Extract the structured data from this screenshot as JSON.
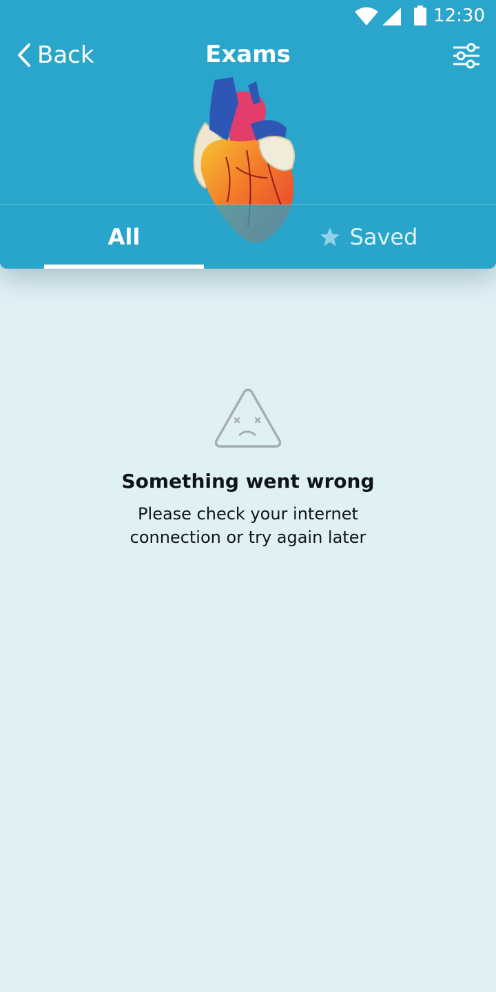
{
  "status_bar": {
    "time": "12:30",
    "icons": [
      "wifi-icon",
      "signal-icon",
      "battery-icon"
    ]
  },
  "header": {
    "back_label": "Back",
    "title": "Exams",
    "filter_icon": "sliders-icon",
    "image": "anatomical-heart-model"
  },
  "tabs": [
    {
      "label": "All",
      "selected": true
    },
    {
      "label": "Saved",
      "icon": "star-icon",
      "selected": false
    }
  ],
  "error": {
    "icon": "sad-triangle-icon",
    "title": "Something went wrong",
    "message": "Please check your internet connection or try again later"
  },
  "colors": {
    "header_bg": "#2aa5cb",
    "page_bg": "#e0f1f6",
    "text_dark": "#0f1418",
    "icon_gray": "#a5adb1",
    "star": "#8fd3ea"
  }
}
